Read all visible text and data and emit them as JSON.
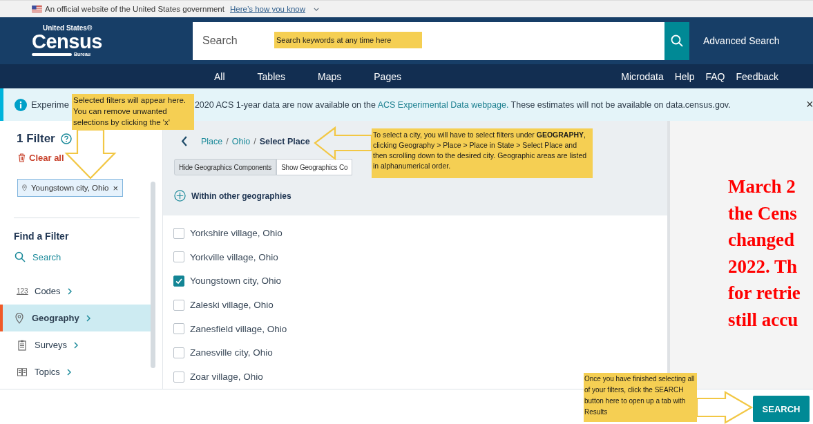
{
  "gov_banner": {
    "text": "An official website of the United States government",
    "link": "Here’s how you know"
  },
  "header": {
    "logo": {
      "top": "United States®",
      "name": "Census",
      "bottom": "Bureau"
    },
    "search": {
      "placeholder": "Search"
    },
    "advanced": "Advanced Search"
  },
  "nav": {
    "left": [
      "All",
      "Tables",
      "Maps",
      "Pages"
    ],
    "right": [
      "Microdata",
      "Help",
      "FAQ",
      "Feedback"
    ]
  },
  "notice": {
    "lead": "Experime",
    "text": "2020 ACS 1-year data are now available on the",
    "link": "ACS Experimental Data webpage.",
    "tail": "These estimates will not be available on data.census.gov.",
    "close": "×"
  },
  "sidebar": {
    "filter_count": "1 Filter",
    "clear": "Clear all",
    "chips": [
      {
        "label": "Youngstown city, Ohio",
        "remove": "×"
      }
    ],
    "find_title": "Find a Filter",
    "search": "Search",
    "categories": [
      {
        "kind": "codes",
        "badge": "123",
        "label": "Codes",
        "selected": false
      },
      {
        "kind": "geography",
        "label": "Geography",
        "selected": true
      },
      {
        "kind": "surveys",
        "label": "Surveys",
        "selected": false
      },
      {
        "kind": "topics",
        "label": "Topics",
        "selected": false
      }
    ]
  },
  "panel": {
    "breadcrumb": [
      {
        "label": "Place",
        "current": false
      },
      {
        "label": "Ohio",
        "current": false
      },
      {
        "label": "Select Place",
        "current": true
      }
    ],
    "separator": "/",
    "toggles": [
      {
        "label": "Hide Geographics Components",
        "selected": true
      },
      {
        "label": "Show Geographics Co",
        "selected": false
      }
    ],
    "within": "Within other geographies",
    "places": [
      {
        "label": "Yorkshire village, Ohio",
        "checked": false
      },
      {
        "label": "Yorkville village, Ohio",
        "checked": false
      },
      {
        "label": "Youngstown city, Ohio",
        "checked": true
      },
      {
        "label": "Zaleski village, Ohio",
        "checked": false
      },
      {
        "label": "Zanesfield village, Ohio",
        "checked": false
      },
      {
        "label": "Zanesville city, Ohio",
        "checked": false
      },
      {
        "label": "Zoar village, Ohio",
        "checked": false
      }
    ]
  },
  "note": [
    "March 2",
    "the Cens",
    "changed",
    "2022. Th",
    "for retrie",
    "still accu"
  ],
  "search_button": "SEARCH",
  "callouts": [
    {
      "kind": "search",
      "text": "Search keywords at any time here"
    },
    {
      "kind": "filters",
      "text": "Selected filters will appear here. You can remove unwanted selections by clicking the 'x'"
    },
    {
      "kind": "city",
      "text": "To select a city, you will have to select filters under **GEOGRAPHY**, clicking Geography > Place > Place in State > Select Place and then scrolling down to the desired city. Geographic areas are listed in alphanumerical order."
    },
    {
      "kind": "submit",
      "text": "Once you have finished selecting all of your filters, click the SEARCH button here to open up a tab with Results"
    }
  ]
}
